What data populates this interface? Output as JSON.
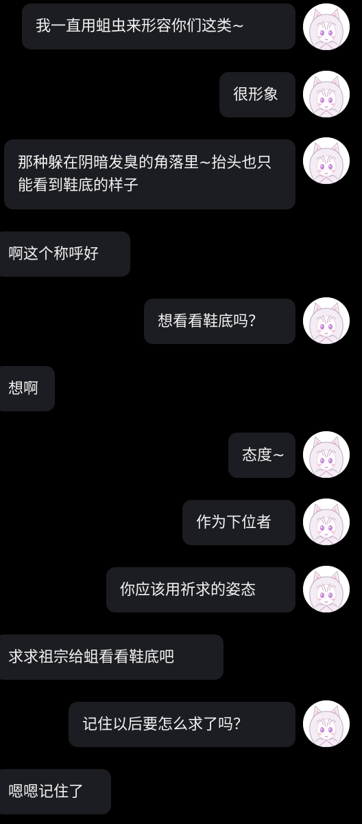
{
  "messages": [
    {
      "side": "right",
      "text": "我一直用蛆虫来形容你们这类~"
    },
    {
      "side": "right",
      "text": "很形象"
    },
    {
      "side": "right",
      "text": "那种躲在阴暗发臭的角落里~抬头也只能看到鞋底的样子"
    },
    {
      "side": "left",
      "text": "啊这个称呼好"
    },
    {
      "side": "right",
      "text": "想看看鞋底吗？"
    },
    {
      "side": "left",
      "text": "想啊"
    },
    {
      "side": "right",
      "text": "态度~"
    },
    {
      "side": "right",
      "text": "作为下位者"
    },
    {
      "side": "right",
      "text": "你应该用祈求的姿态"
    },
    {
      "side": "left",
      "text": "求求祖宗给蛆看看鞋底吧"
    },
    {
      "side": "right",
      "text": "记住以后要怎么求了吗？"
    },
    {
      "side": "left",
      "text": "嗯嗯记住了"
    }
  ],
  "avatar_icon": "anime-cat-girl-avatar-icon",
  "colors": {
    "background": "#000000",
    "bubble": "#1c1d22",
    "text": "#f2f2f2"
  }
}
